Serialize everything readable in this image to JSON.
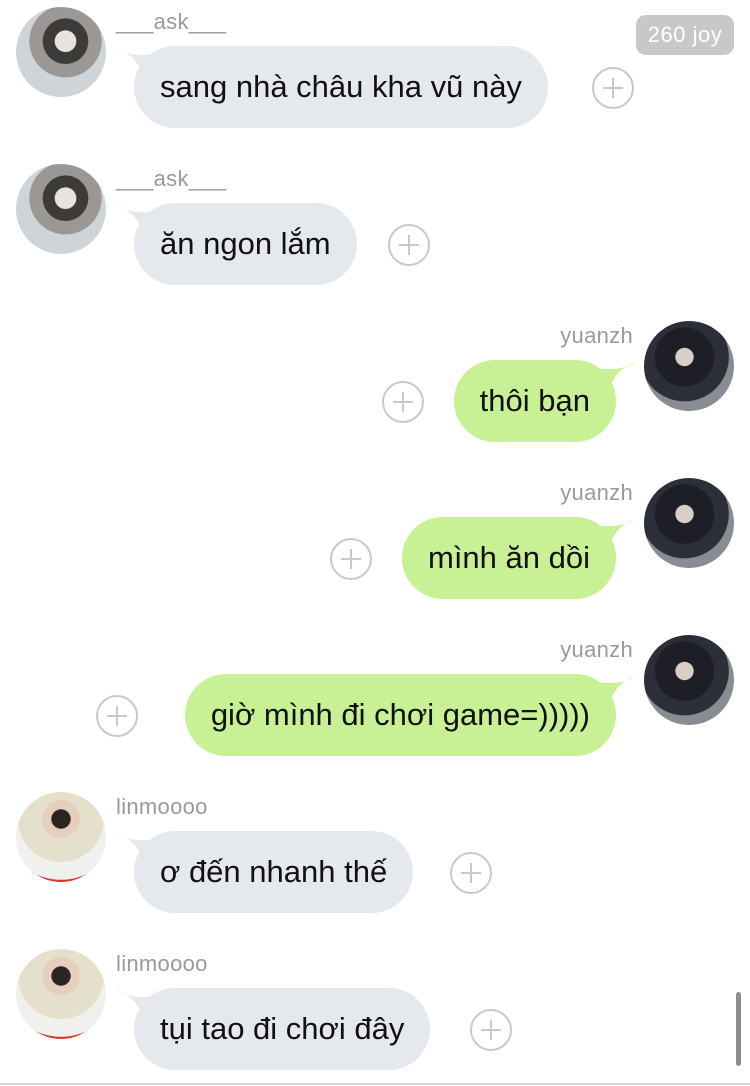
{
  "badge": {
    "text": "260 joy"
  },
  "messages": [
    {
      "sender": "___ask___",
      "side": "left",
      "avatar": "avatar-ask",
      "text": "sang nhà châu kha vũ này"
    },
    {
      "sender": "___ask___",
      "side": "left",
      "avatar": "avatar-ask",
      "text": "ăn ngon lắm"
    },
    {
      "sender": "yuanzh",
      "side": "right",
      "avatar": "avatar-yuanzh",
      "text": "thôi bạn"
    },
    {
      "sender": "yuanzh",
      "side": "right",
      "avatar": "avatar-yuanzh",
      "text": "mình ăn dồi"
    },
    {
      "sender": "yuanzh",
      "side": "right",
      "avatar": "avatar-yuanzh",
      "text": "giờ mình đi chơi game=)))))"
    },
    {
      "sender": "linmoooo",
      "side": "left",
      "avatar": "avatar-linmoooo",
      "text": "ơ đến nhanh thế"
    },
    {
      "sender": "linmoooo",
      "side": "left",
      "avatar": "avatar-linmoooo",
      "text": "tụi tao đi chơi đây"
    }
  ],
  "icons": {
    "reaction": "plus-circle-icon"
  },
  "colors": {
    "incoming_bubble": "#e5e8ec",
    "outgoing_bubble": "#c8f095",
    "username": "#9a9a9a",
    "badge_bg": "#c8c8c8"
  }
}
